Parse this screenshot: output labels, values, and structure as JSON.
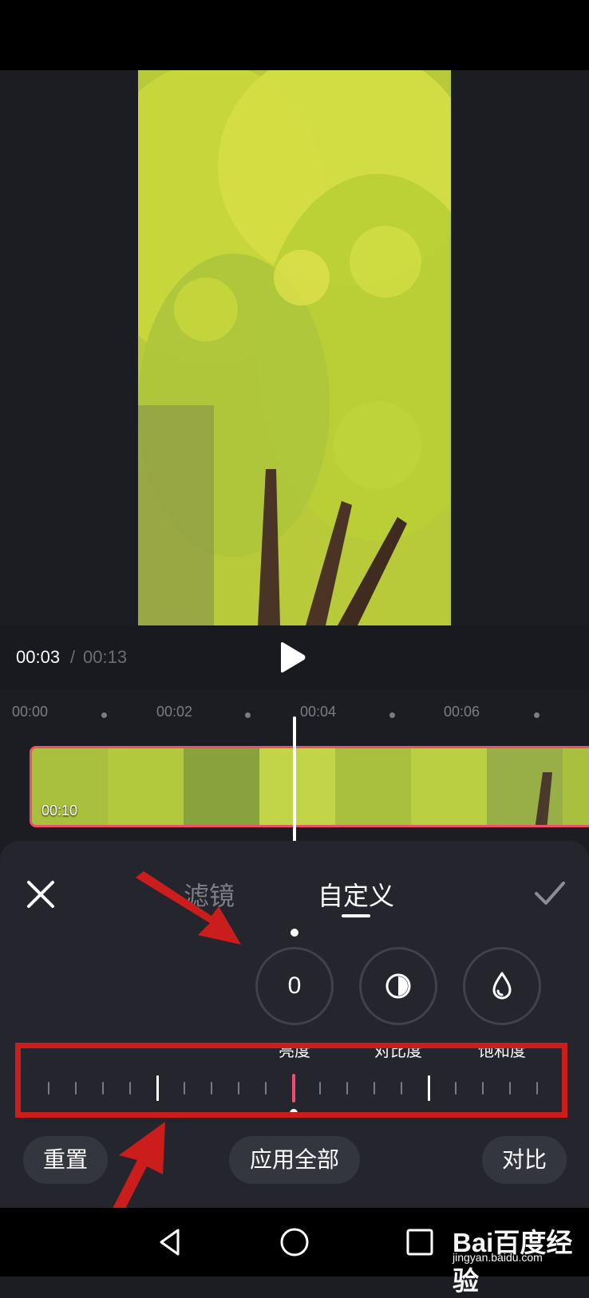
{
  "player": {
    "current_time": "00:03",
    "separator": "/",
    "total_time": "00:13"
  },
  "timeline": {
    "ticks": [
      "00:00",
      "00:02",
      "00:04",
      "00:06"
    ],
    "clip_duration": "00:10"
  },
  "panel": {
    "tabs": [
      "滤镜",
      "自定义"
    ],
    "active_tab": "自定义",
    "tools": [
      {
        "label": "亮度",
        "value": "0",
        "icon": "value-display"
      },
      {
        "label": "对比度",
        "icon": "contrast-icon"
      },
      {
        "label": "饱和度",
        "icon": "saturation-drop-icon"
      }
    ],
    "slider": {
      "value": 0,
      "min": -100,
      "max": 100
    },
    "buttons": {
      "reset": "重置",
      "apply_all": "应用全部",
      "compare": "对比"
    }
  },
  "navigation": [
    "back-icon",
    "home-icon",
    "recent-apps-icon"
  ],
  "watermark": {
    "brand": "Bai百度经验",
    "site": "jingyan.baidu.com"
  },
  "colors": {
    "accent": "#ef4e6c",
    "annotation": "#cc1d1d",
    "background": "#1c1d22",
    "panel": "#25262d"
  }
}
